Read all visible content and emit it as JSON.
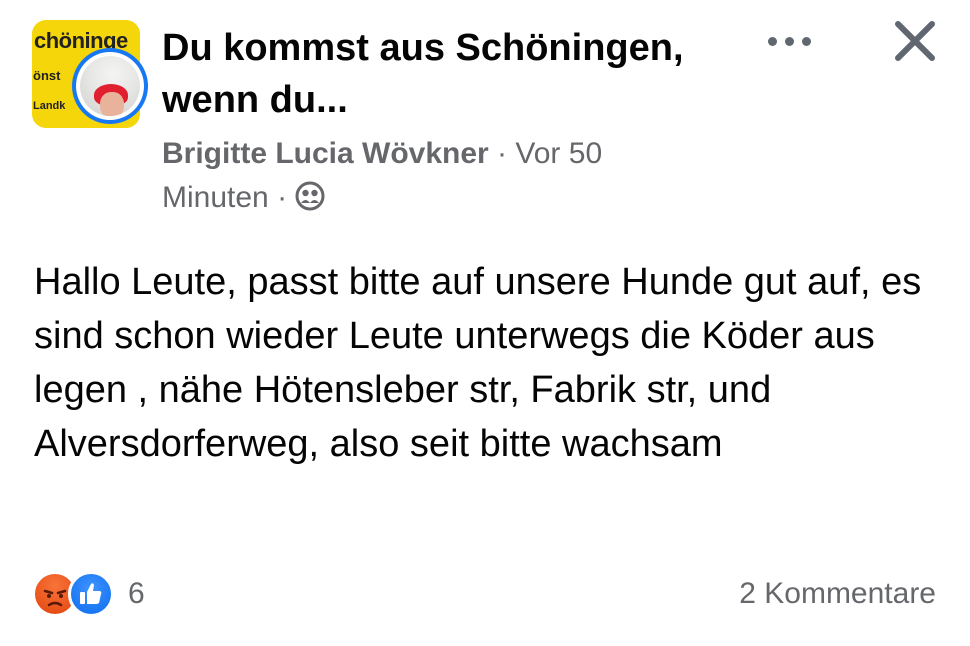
{
  "header": {
    "group_avatar": {
      "line1": "chöninge",
      "line2": "önst",
      "line3": "Landk",
      "color": "#f5d60a"
    },
    "group_name": "Du kommst aus Schöningen, wenn du...",
    "author": "Brigitte Lucia Wövkner",
    "separator": " · ",
    "timestamp": "Vor 50 Minuten",
    "audience_icon": "group-members-icon",
    "more_icon": "more-dots-icon",
    "close_icon": "close-icon"
  },
  "post": {
    "text": "Hallo Leute, passt bitte auf unsere Hunde gut auf, es  sind schon wieder Leute unterwegs die Köder aus legen , nähe Hötensleber str, Fabrik str, und Alversdorferweg, also seit bitte wachsam"
  },
  "footer": {
    "reactions": [
      "angry-reaction-icon",
      "like-reaction-icon"
    ],
    "reaction_count": "6",
    "comments": "2 Kommentare"
  },
  "colors": {
    "accent": "#1877f2",
    "secondary_text": "#65676b",
    "primary_text": "#050505",
    "angry": "#e9531a"
  }
}
